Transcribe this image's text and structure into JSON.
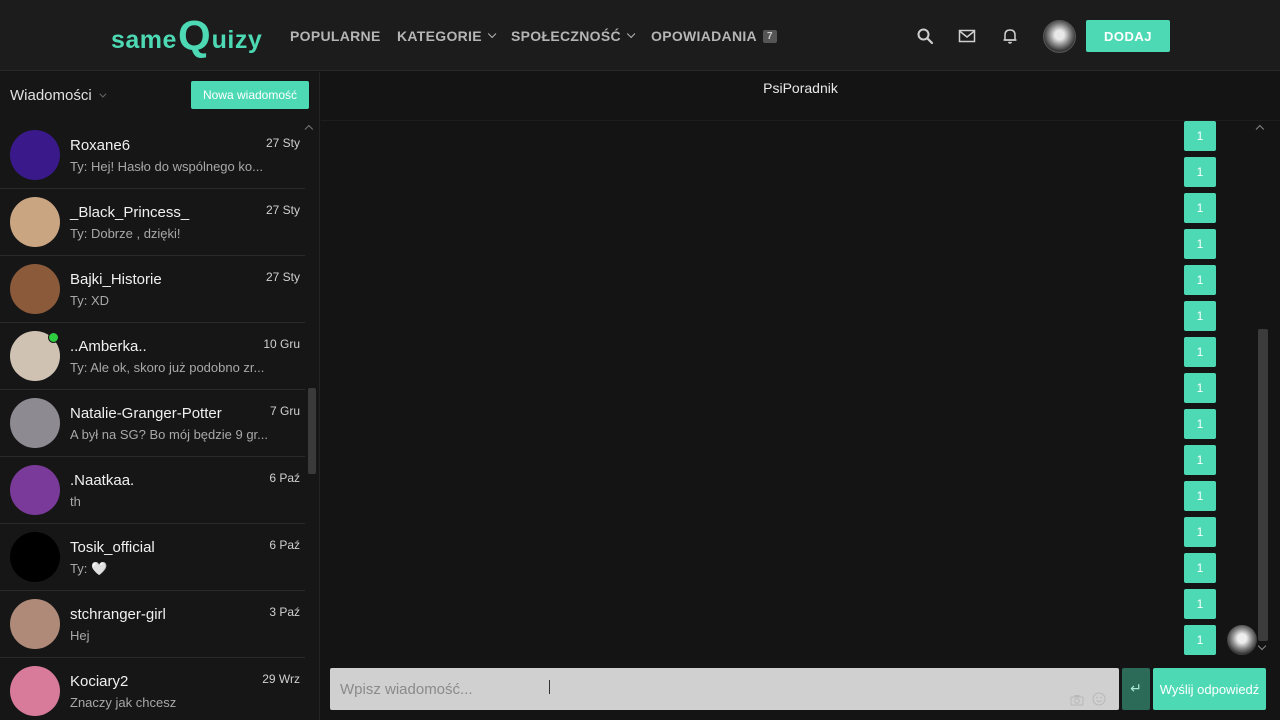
{
  "logo": {
    "part1": "same",
    "part2": "Q",
    "part3": "uizy"
  },
  "nav": {
    "items": [
      {
        "label": "POPULARNE",
        "dropdown": false
      },
      {
        "label": "KATEGORIE",
        "dropdown": true
      },
      {
        "label": "SPOŁECZNOŚĆ",
        "dropdown": true
      },
      {
        "label": "OPOWIADANIA",
        "dropdown": false,
        "badge": "7"
      }
    ],
    "icons": [
      "search-icon",
      "mail-icon",
      "bell-icon"
    ],
    "add_label": "DODAJ"
  },
  "messages_panel": {
    "title": "Wiadomości",
    "new_message_label": "Nowa wiadomość",
    "conversations": [
      {
        "name": "Roxane6",
        "date": "27 Sty",
        "preview": "Ty: Hej! Hasło do wspólnego ko...",
        "online": false,
        "avatar_color": "#3a1a8a"
      },
      {
        "name": "_Black_Princess_",
        "date": "27 Sty",
        "preview": "Ty: Dobrze , dzięki!",
        "online": false,
        "avatar_color": "#c9a582"
      },
      {
        "name": "Bajki_Historie",
        "date": "27 Sty",
        "preview": "Ty: XD",
        "online": false,
        "avatar_color": "#8a5a3a"
      },
      {
        "name": "..Amberka..",
        "date": "10 Gru",
        "preview": "Ty: Ale ok, skoro już podobno zr...",
        "online": true,
        "avatar_color": "#cfc2b2"
      },
      {
        "name": "Natalie-Granger-Potter",
        "date": "7 Gru",
        "preview": "A był na SG? Bo mój będzie 9 gr...",
        "online": false,
        "avatar_color": "#8d8a92"
      },
      {
        "name": ".Naatkaa.",
        "date": "6 Paź",
        "preview": "th",
        "online": false,
        "avatar_color": "#7a3a9a"
      },
      {
        "name": "Tosik_official",
        "date": "6 Paź",
        "preview": "Ty: 🤍",
        "online": false,
        "avatar_color": "#000000"
      },
      {
        "name": "stchranger-girl",
        "date": "3 Paź",
        "preview": "Hej",
        "online": false,
        "avatar_color": "#b08a78"
      },
      {
        "name": "Kociary2",
        "date": "29 Wrz",
        "preview": "Znaczy jak chcesz",
        "online": false,
        "avatar_color": "#d87a9a"
      }
    ]
  },
  "chat": {
    "title": "PsiPoradnik",
    "messages": [
      "1",
      "1",
      "1",
      "1",
      "1",
      "1",
      "1",
      "1",
      "1",
      "1",
      "1",
      "1",
      "1",
      "1",
      "1"
    ],
    "input_placeholder": "Wpisz wiadomość...",
    "enter_symbol": "↵",
    "send_label": "Wyślij odpowiedź"
  },
  "colors": {
    "accent": "#4dd9b4",
    "background": "#141414",
    "navbar": "#1c1c1c"
  }
}
